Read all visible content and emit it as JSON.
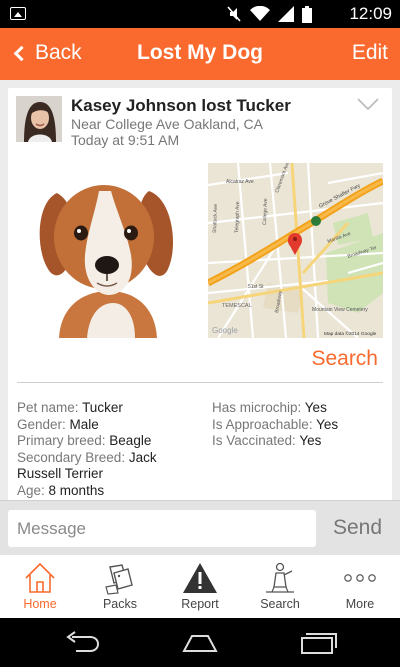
{
  "status_bar": {
    "time": "12:09",
    "icons": [
      "image-icon",
      "mute-icon",
      "wifi-icon",
      "signal-icon",
      "battery-icon"
    ]
  },
  "app_bar": {
    "back_label": "Back",
    "title": "Lost My Dog",
    "edit_label": "Edit",
    "color": "#fa6a2e"
  },
  "post": {
    "title": "Kasey Johnson lost Tucker",
    "location": "Near College Ave Oakland, CA",
    "time": "Today at 9:51 AM"
  },
  "map": {
    "streets": [
      "Alcatraz Ave",
      "Claremont Ave",
      "Telegraph Ave",
      "College Ave",
      "Shattuck Ave",
      "Grove Shafter Fwy",
      "Manila Ave",
      "Broadway Ter",
      "51st St",
      "Broadway",
      "Mountain View Cemetery",
      "TEMESCAL"
    ],
    "attribution": "Map data ©2014 Google",
    "logo": "Google"
  },
  "search_label": "Search",
  "details": {
    "left": [
      {
        "label": "Pet name:",
        "value": "Tucker"
      },
      {
        "label": "Gender:",
        "value": "Male"
      },
      {
        "label": "Primary breed:",
        "value": "Beagle"
      },
      {
        "label": "Secondary Breed:",
        "value": "Jack Russell Terrier"
      },
      {
        "label": "Age:",
        "value": "8 months"
      }
    ],
    "right": [
      {
        "label": "Has microchip:",
        "value": "Yes"
      },
      {
        "label": "Is Approachable:",
        "value": "Yes"
      },
      {
        "label": "Is Vaccinated:",
        "value": "Yes"
      }
    ]
  },
  "message": {
    "placeholder": "Message",
    "send_label": "Send"
  },
  "tabs": [
    {
      "label": "Home",
      "icon": "home-icon",
      "active": true
    },
    {
      "label": "Packs",
      "icon": "dog-tags-icon",
      "active": false
    },
    {
      "label": "Report",
      "icon": "warning-icon",
      "active": false
    },
    {
      "label": "Search",
      "icon": "search-person-icon",
      "active": false
    },
    {
      "label": "More",
      "icon": "more-icon",
      "active": false
    }
  ],
  "nav": {
    "icons": [
      "back-icon",
      "home-icon",
      "recents-icon"
    ]
  }
}
